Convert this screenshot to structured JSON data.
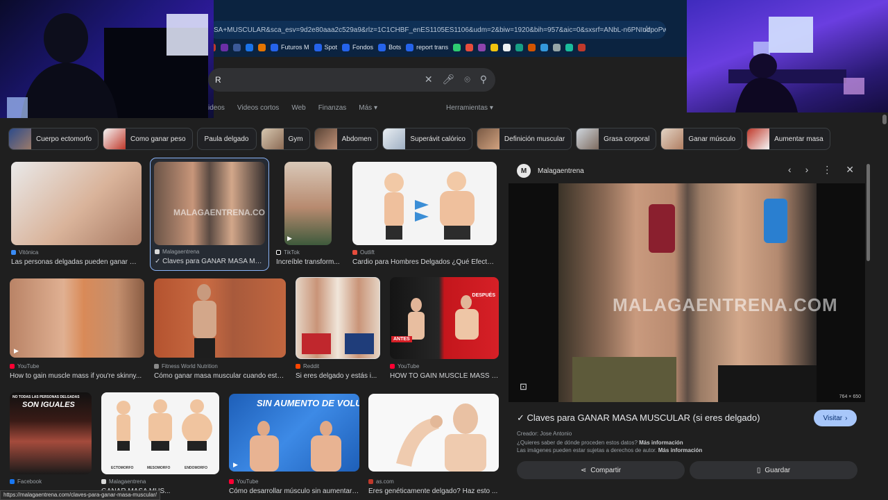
{
  "browser": {
    "url": "SA+MUSCULAR&sca_esv=9d2e80aaa2c529a9&rlz=1C1CHBF_enES1105ES1106&udm=2&biw=1920&bih=957&aic=0&sxsrf=ANbL-n6PNIudpoPw...",
    "bookmarks": [
      "Futuros M",
      "Spot",
      "Fondos",
      "Bots",
      "report trans"
    ],
    "status_url": "https://malagaentrena.com/claves-para-ganar-masa-muscular/"
  },
  "search": {
    "query": "R",
    "tabs": [
      "ideos",
      "Videos cortos",
      "Web",
      "Finanzas",
      "Más"
    ],
    "tools": "Herramientas"
  },
  "chips": [
    {
      "label": "Cuerpo ectomorfo"
    },
    {
      "label": "Como ganar peso"
    },
    {
      "label": "Paula delgado"
    },
    {
      "label": "Gym"
    },
    {
      "label": "Abdomen"
    },
    {
      "label": "Superávit calórico"
    },
    {
      "label": "Definición muscular"
    },
    {
      "label": "Grasa corporal"
    },
    {
      "label": "Ganar músculo"
    },
    {
      "label": "Aumentar masa"
    }
  ],
  "results": [
    {
      "source": "Vitónica",
      "title": "Las personas delgadas pueden ganar mú..."
    },
    {
      "source": "Malagaentrena",
      "title": "✓ Claves para GANAR MASA MU..."
    },
    {
      "source": "TikTok",
      "title": "Increíble transform..."
    },
    {
      "source": "Outlift",
      "title": "Cardio para Hombres Delgados ¿Qué Efecto ..."
    },
    {
      "source": "YouTube",
      "title": "How to gain muscle mass if you're skinny..."
    },
    {
      "source": "Fitness World Nutrition",
      "title": "Cómo ganar masa muscular cuando está..."
    },
    {
      "source": "Reddit",
      "title": "Si eres delgado y estás i..."
    },
    {
      "source": "YouTube",
      "title": "HOW TO GAIN MUSCLE MASS I..."
    },
    {
      "source": "Facebook",
      "title": ""
    },
    {
      "source": "Malagaentrena",
      "title": "GANAR MASA MUS..."
    },
    {
      "source": "YouTube",
      "title": "Cómo desarrollar músculo sin aumentar ..."
    },
    {
      "source": "as.com",
      "title": "Eres genéticamente delgado? Haz esto ..."
    }
  ],
  "image_text": {
    "watermark": "MALAGAENTRENA.COM",
    "r2_overlay": "SON IGUALES",
    "r2_top": "NO TODAS LAS PERSONAS DELGADAS",
    "r3_headline": "SIN AUMENTO DE VOLUMEN",
    "ecto": "ECTOMORFO",
    "meso": "MESOMORFO",
    "endo": "ENDOMORFO",
    "antes": "ANTES",
    "despues": "DESPUÉS"
  },
  "panel": {
    "site": "Malagaentrena",
    "title": "✓ Claves para GANAR MASA MUSCULAR (si eres delgado)",
    "visit": "Visitar",
    "creator": "Creador: Jose Antonio",
    "q1": "¿Quieres saber de dónde proceden estos datos?",
    "q1_link": "Más información",
    "q2": "Las imágenes pueden estar sujetas a derechos de autor.",
    "q2_link": "Más información",
    "share": "Compartir",
    "save": "Guardar",
    "dims": "764 × 650",
    "watermark": "MALAGAENTRENA.COM"
  }
}
